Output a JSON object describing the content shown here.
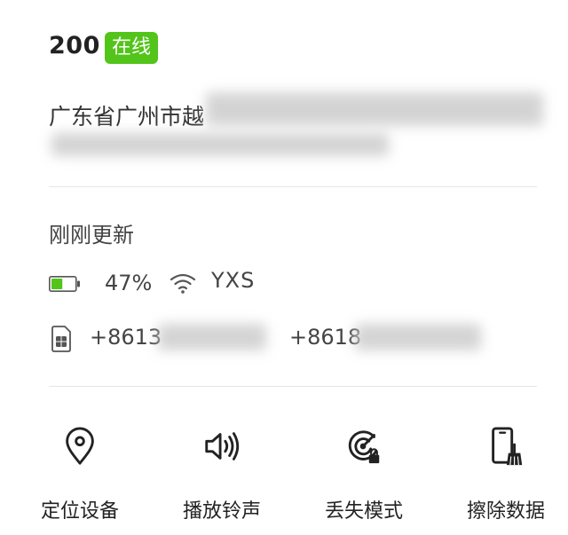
{
  "device": {
    "name": "200",
    "status": "在线"
  },
  "address": {
    "line1": "广东省广州市越"
  },
  "updated": "刚刚更新",
  "battery": {
    "percent": "47%",
    "level": 0.47
  },
  "wifi": {
    "name": "YXS"
  },
  "sims": [
    {
      "number": "+8613"
    },
    {
      "number": "+8618"
    }
  ],
  "actions": [
    {
      "label": "定位设备",
      "icon": "location-pin-icon"
    },
    {
      "label": "播放铃声",
      "icon": "speaker-icon"
    },
    {
      "label": "丢失模式",
      "icon": "radar-lock-icon"
    },
    {
      "label": "擦除数据",
      "icon": "phone-broom-icon"
    }
  ],
  "colors": {
    "online_badge": "#52c41a",
    "battery_fill": "#52c41a"
  }
}
